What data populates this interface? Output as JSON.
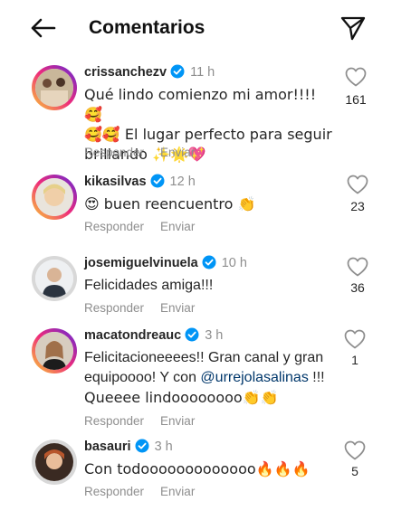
{
  "header": {
    "title": "Comentarios",
    "back_icon": "arrow-left-icon",
    "send_icon": "paper-plane-icon"
  },
  "actions": {
    "reply": "Responder",
    "send": "Enviar"
  },
  "comments": [
    {
      "username": "crissanchezv",
      "time": "11 h",
      "text_lines": [
        "Qué lindo comienzo mi amor!!!! 🥰",
        "🥰🥰 El lugar perfecto para seguir",
        "brillando ✨🌟💖"
      ],
      "likes": "161",
      "verified": true
    },
    {
      "username": "kikasilvas",
      "time": "12 h",
      "text_lines": [
        "😍 buen reencuentro 👏"
      ],
      "likes": "23",
      "verified": true
    },
    {
      "username": "josemiguelvinuela",
      "time": "10 h",
      "text_lines": [
        "Felicidades amiga!!!"
      ],
      "likes": "36",
      "verified": true
    },
    {
      "username": "macatondreauc",
      "time": "3 h",
      "text_line1": "Felicitacioneeees!! Gran canal y gran",
      "text_line2_pre": "equipoooo! Y con ",
      "mention": "@urrejolasalinas",
      "text_line2_post": " !!!",
      "text_line3": "Queeee lindoooooooo👏👏",
      "likes": "1",
      "verified": true
    },
    {
      "username": "basauri",
      "time": "3 h",
      "text_lines": [
        "Con todooooooooooooo🔥🔥🔥"
      ],
      "likes": "5",
      "verified": true
    }
  ]
}
